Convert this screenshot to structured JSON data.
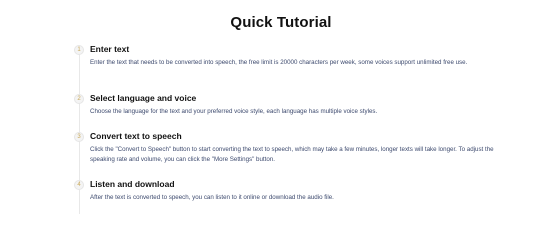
{
  "page": {
    "title": "Quick Tutorial"
  },
  "steps": [
    {
      "number": "1",
      "title": "Enter text",
      "description": "Enter the text that needs to be converted into speech, the free limit is 20000 characters per week, some voices support unlimited free use."
    },
    {
      "number": "2",
      "title": "Select language and voice",
      "description": "Choose the language for the text and your preferred voice style, each language has multiple voice styles."
    },
    {
      "number": "3",
      "title": "Convert text to speech",
      "description": "Click the \"Convert to Speech\" button to start converting the text to speech, which may take a few minutes, longer texts will take longer. To adjust the speaking rate and volume, you can click the \"More Settings\" button."
    },
    {
      "number": "4",
      "title": "Listen and download",
      "description": "After the text is converted to speech, you can listen to it online or download the audio file."
    }
  ]
}
